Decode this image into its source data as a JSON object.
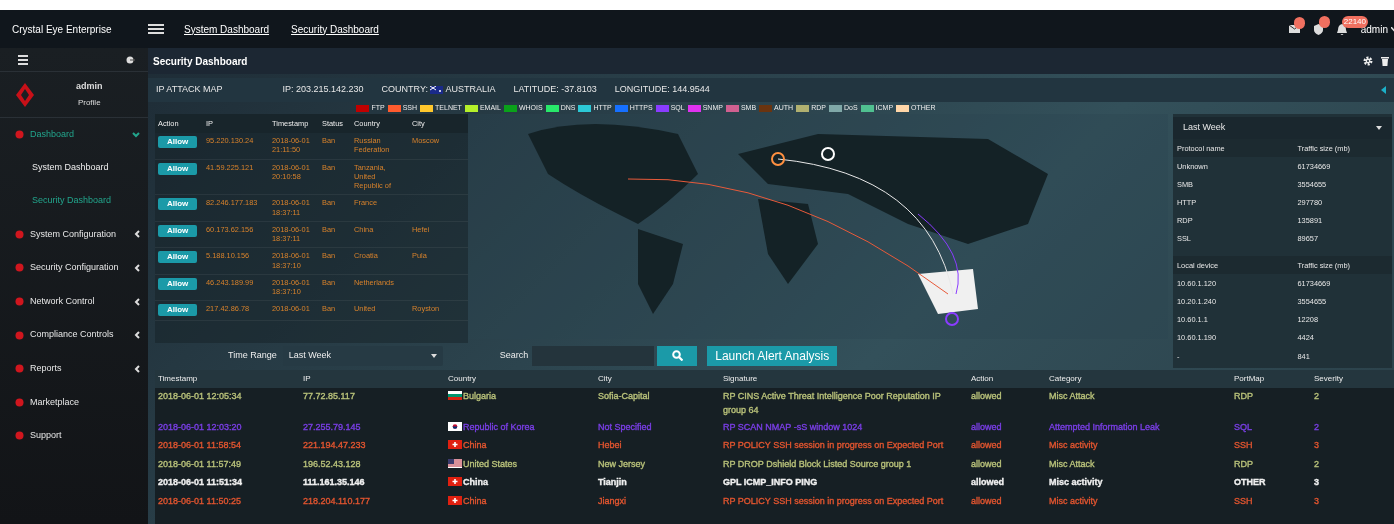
{
  "topbar": {
    "brand": "Crystal Eye Enterprise",
    "links": [
      "System Dashboard",
      "Security Dashboard"
    ],
    "notifications": [
      {
        "kind": "mail"
      },
      {
        "kind": "shield"
      },
      {
        "kind": "bell",
        "badge": "22140"
      }
    ],
    "user": "admin"
  },
  "sidebar": {
    "user": "admin",
    "profile": "Profile",
    "items": [
      {
        "label": "Dashboard",
        "kind": "group",
        "expanded": true,
        "children": [
          {
            "label": "System Dashboard",
            "selected": false
          },
          {
            "label": "Security Dashboard",
            "selected": true
          }
        ]
      },
      {
        "label": "System Configuration",
        "kind": "group",
        "expanded": false
      },
      {
        "label": "Security Configuration",
        "kind": "group",
        "expanded": false
      },
      {
        "label": "Network Control",
        "kind": "group",
        "expanded": false
      },
      {
        "label": "Compliance Controls",
        "kind": "group",
        "expanded": false
      },
      {
        "label": "Reports",
        "kind": "group",
        "expanded": false
      },
      {
        "label": "Marketplace",
        "kind": "link"
      },
      {
        "label": "Support",
        "kind": "link"
      }
    ]
  },
  "page": {
    "title": "Security Dashboard"
  },
  "info_bar": {
    "title": "IP ATTACK MAP",
    "ip": "IP: 203.215.142.230",
    "country_label": "COUNTRY:",
    "country": "AUSTRALIA",
    "latitude": "LATITUDE: -37.8103",
    "longitude": "LONGITUDE: 144.9544"
  },
  "legend": [
    {
      "label": "FTP",
      "color": "#c00000"
    },
    {
      "label": "SSH",
      "color": "#ff5b2e"
    },
    {
      "label": "TELNET",
      "color": "#ffc72c"
    },
    {
      "label": "EMAIL",
      "color": "#b5f02a"
    },
    {
      "label": "WHOIS",
      "color": "#0aa11a"
    },
    {
      "label": "DNS",
      "color": "#28e86a"
    },
    {
      "label": "HTTP",
      "color": "#2cc8d6"
    },
    {
      "label": "HTTPS",
      "color": "#1670ff"
    },
    {
      "label": "SQL",
      "color": "#8a3cff"
    },
    {
      "label": "SNMP",
      "color": "#e032f0"
    },
    {
      "label": "SMB",
      "color": "#d06090"
    },
    {
      "label": "AUTH",
      "color": "#6a3410"
    },
    {
      "label": "RDP",
      "color": "#b0b070"
    },
    {
      "label": "DoS",
      "color": "#80a8a8"
    },
    {
      "label": "ICMP",
      "color": "#50c090"
    },
    {
      "label": "OTHER",
      "color": "#ffd6a8"
    }
  ],
  "attacks": {
    "columns": [
      "Action",
      "IP",
      "Timestamp",
      "Status",
      "Country",
      "City"
    ],
    "rows": [
      {
        "action": "Allow",
        "ip": "95.220.130.24",
        "timestamp": "2018-06-01 21:11:50",
        "status": "Ban",
        "country": "Russian Federation",
        "city": "Moscow"
      },
      {
        "action": "Allow",
        "ip": "41.59.225.121",
        "timestamp": "2018-06-01 20:10:58",
        "status": "Ban",
        "country": "Tanzania, United Republic of"
      },
      {
        "action": "Allow",
        "ip": "82.246.177.183",
        "timestamp": "2018-06-01 18:37:11",
        "status": "Ban",
        "country": "France"
      },
      {
        "action": "Allow",
        "ip": "60.173.62.156",
        "timestamp": "2018-06-01 18:37:11",
        "status": "Ban",
        "country": "China",
        "city": "Hefei"
      },
      {
        "action": "Allow",
        "ip": "5.188.10.156",
        "timestamp": "2018-06-01 18:37:10",
        "status": "Ban",
        "country": "Croatia",
        "city": "Pula"
      },
      {
        "action": "Allow",
        "ip": "46.243.189.99",
        "timestamp": "2018-06-01 18:37:10",
        "status": "Ban",
        "country": "Netherlands"
      },
      {
        "action": "Allow",
        "ip": "217.42.86.78",
        "timestamp": "2018-06-01",
        "status": "Ban",
        "country": "United",
        "city": "Royston"
      }
    ]
  },
  "traffic": {
    "range": "Last Week",
    "protocols": {
      "columns": [
        "Protocol name",
        "Traffic size (mb)"
      ],
      "rows": [
        [
          "Unknown",
          "61734669"
        ],
        [
          "SMB",
          "3554655"
        ],
        [
          "HTTP",
          "297780"
        ],
        [
          "RDP",
          "135891"
        ],
        [
          "SSL",
          "89657"
        ]
      ]
    },
    "devices": {
      "columns": [
        "Local device",
        "Traffic size (mb)"
      ],
      "rows": [
        [
          "10.60.1.120",
          "61734669"
        ],
        [
          "10.20.1.240",
          "3554655"
        ],
        [
          "10.60.1.1",
          "12208"
        ],
        [
          "10.60.1.190",
          "4424"
        ],
        [
          "-",
          "841"
        ]
      ]
    }
  },
  "controls": {
    "time_range_label": "Time Range",
    "time_range": "Last Week",
    "search_label": "Search",
    "launch": "Launch Alert Analysis"
  },
  "events": {
    "columns": [
      "Timestamp",
      "IP",
      "Country",
      "City",
      "Signature",
      "Action",
      "Category",
      "PortMap",
      "Severity"
    ],
    "rows": [
      {
        "timestamp": "2018-06-01 12:05:34",
        "ip": "77.72.85.117",
        "kind": "bg",
        "country": "Bulgaria",
        "city": "Sofia-Capital",
        "signature": "RP CINS Active Threat Intelligence Poor Reputation IP group 64",
        "action": "allowed",
        "category": "Misc Attack",
        "portmap": "RDP",
        "severity": "2",
        "color": "#b9c27a",
        "bold": false
      },
      {
        "timestamp": "2018-06-01 12:03:20",
        "ip": "27.255.79.145",
        "kind": "kr",
        "country": "Republic of Korea",
        "city": "Not Specified",
        "signature": "RP SCAN NMAP -sS window 1024",
        "action": "allowed",
        "category": "Attempted Information Leak",
        "portmap": "SQL",
        "severity": "2",
        "color": "#7a3ee6",
        "bold": false
      },
      {
        "timestamp": "2018-06-01 11:58:54",
        "ip": "221.194.47.233",
        "kind": "cn",
        "country": "China",
        "city": "Hebei",
        "signature": "RP POLICY SSH session in progress on Expected Port",
        "action": "allowed",
        "category": "Misc activity",
        "portmap": "SSH",
        "severity": "3",
        "color": "#e2552f",
        "bold": false
      },
      {
        "timestamp": "2018-06-01 11:57:49",
        "ip": "196.52.43.128",
        "kind": "us",
        "country": "United States",
        "city": "New Jersey",
        "signature": "RP DROP Dshield Block Listed Source group 1",
        "action": "allowed",
        "category": "Misc Attack",
        "portmap": "RDP",
        "severity": "2",
        "color": "#b9c27a",
        "bold": false
      },
      {
        "timestamp": "2018-06-01 11:51:34",
        "ip": "111.161.35.146",
        "kind": "cn",
        "country": "China",
        "city": "Tianjin",
        "signature": "GPL ICMP_INFO PING",
        "action": "allowed",
        "category": "Misc activity",
        "portmap": "OTHER",
        "severity": "3",
        "color": "#f0f0f0",
        "bold": true
      },
      {
        "timestamp": "2018-06-01 11:50:25",
        "ip": "218.204.110.177",
        "kind": "cn",
        "country": "China",
        "city": "Jiangxi",
        "signature": "RP POLICY SSH session in progress on Expected Port",
        "action": "allowed",
        "category": "Misc activity",
        "portmap": "SSH",
        "severity": "3",
        "color": "#e2552f",
        "bold": false
      }
    ]
  }
}
